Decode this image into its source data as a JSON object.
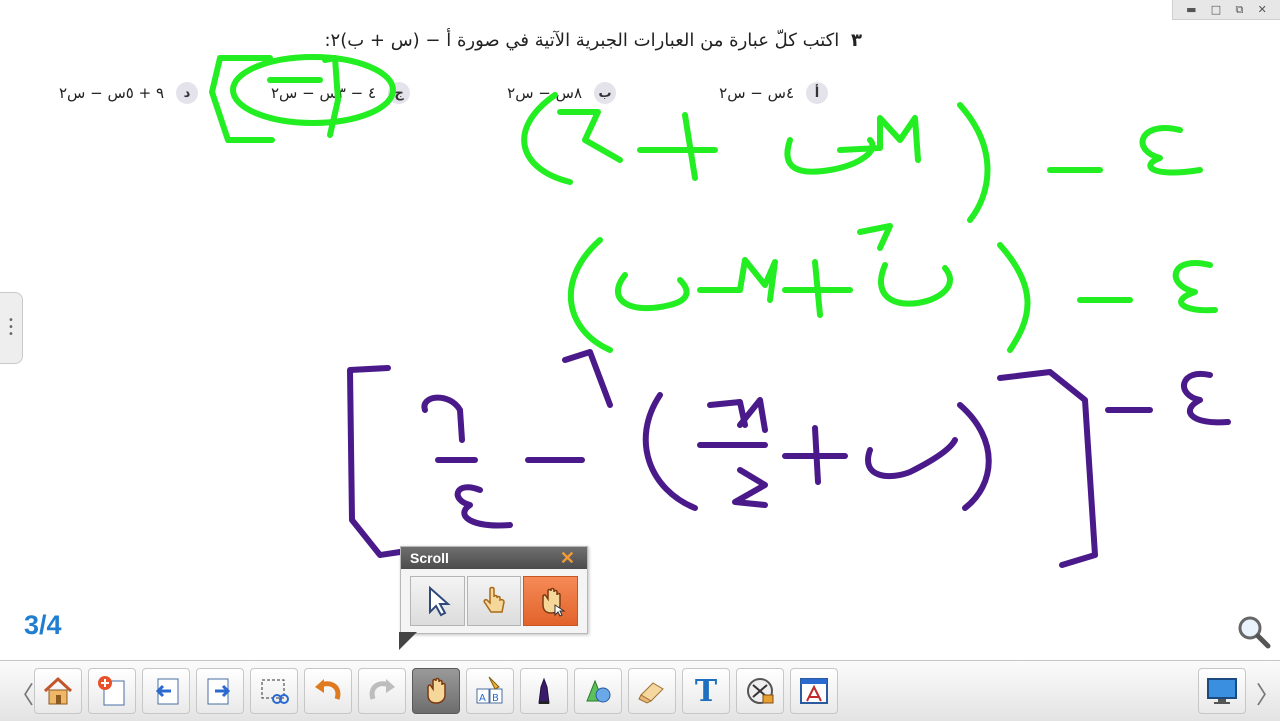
{
  "window_controls": {
    "restore": "▭",
    "minimize": "▬",
    "maximize": "□",
    "restore2": "⧉",
    "close": "✕"
  },
  "problem": {
    "number": "٣",
    "text": "اكتب كلّ عبارة من العبارات الجبرية الآتية في صورة أ − (س + ب)٢:",
    "options": [
      {
        "badge": "أ",
        "expr": "٤س − س٢"
      },
      {
        "badge": "ب",
        "expr": "٨س − س٢"
      },
      {
        "badge": "ج",
        "expr": "٤ − ٣س − س٢"
      },
      {
        "badge": "د",
        "expr": "٩ + ٥س − س٢"
      }
    ]
  },
  "ink_colors": {
    "green": "#22ee22",
    "purple": "#4a1a8a"
  },
  "page_indicator": "3/4",
  "scroll_panel": {
    "title": "Scroll",
    "close_label": "✕",
    "tools": [
      "select-arrow-icon",
      "single-finger-hand-icon",
      "grab-hand-icon"
    ],
    "active_tool": "grab-hand-icon"
  },
  "toolbar": {
    "prev_label": "〈",
    "next_label": "〉",
    "tools": [
      "home-icon",
      "add-page-icon",
      "previous-page-icon",
      "next-page-icon",
      "screen-capture-icon",
      "undo-icon",
      "redo-icon",
      "scroll-hand-icon",
      "text-recognition-icon",
      "pen-icon",
      "shapes-icon",
      "eraser-icon",
      "text-tool-icon",
      "toolbox-icon",
      "page-sorter-icon"
    ],
    "active_tool": "scroll-hand-icon",
    "text_tool_label": "T",
    "screen_icon": "display-screen-icon"
  }
}
